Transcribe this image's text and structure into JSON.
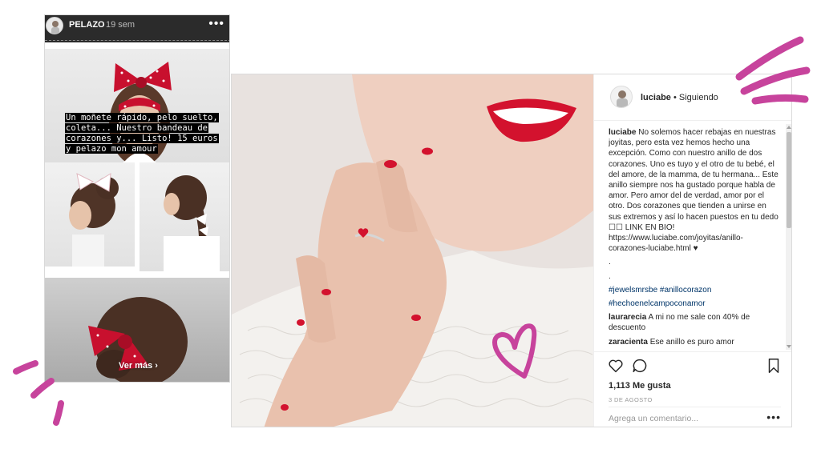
{
  "story": {
    "username": "PELAZO",
    "time": "19 sem",
    "more": "•••",
    "caption": "Un moñete rápido, pelo suelto, coleta... Nuestro bandeau de corazones y... Listo! 15 euros y pelazo mon amour",
    "see_more": "Ver más ›"
  },
  "post": {
    "username": "luciabe",
    "following": " • Siguiendo",
    "caption_user": "luciabe",
    "caption_text": " No solemos hacer rebajas en nuestras joyitas, pero esta vez hemos hecho una excepción. Como con nuestro anillo de dos corazones. Uno es tuyo y el otro de tu bebé, el del amore, de la mamma, de tu hermana... Este anillo siempre nos ha gustado porque habla de amor. Pero amor del de verdad, amor por el otro. Dos corazones que tienden a unirse en sus extremos y así lo hacen puestos en tu dedo ☐☐ LINK EN BIO! https://www.luciabe.com/joyitas/anillo-corazones-luciabe.html ♥",
    "dot1": ".",
    "dot2": ".",
    "hashtags_line1": "#jewelsmrsbe #anillocorazon",
    "hashtags_line2": "#hechoenelcampoconamor",
    "comments": [
      {
        "user": "laurarecia",
        "text": " A mi no me sale con 40% de descuento"
      },
      {
        "user": "zaracienta",
        "text": " Ese anillo es puro amor"
      }
    ],
    "likes": "1,113 Me gusta",
    "date": "3 DE AGOSTO",
    "comment_placeholder": "Agrega un comentario...",
    "comment_more": "•••"
  },
  "colors": {
    "accent_pink": "#c7439c",
    "lips_red": "#d3122e",
    "hashtag_blue": "#003569"
  }
}
